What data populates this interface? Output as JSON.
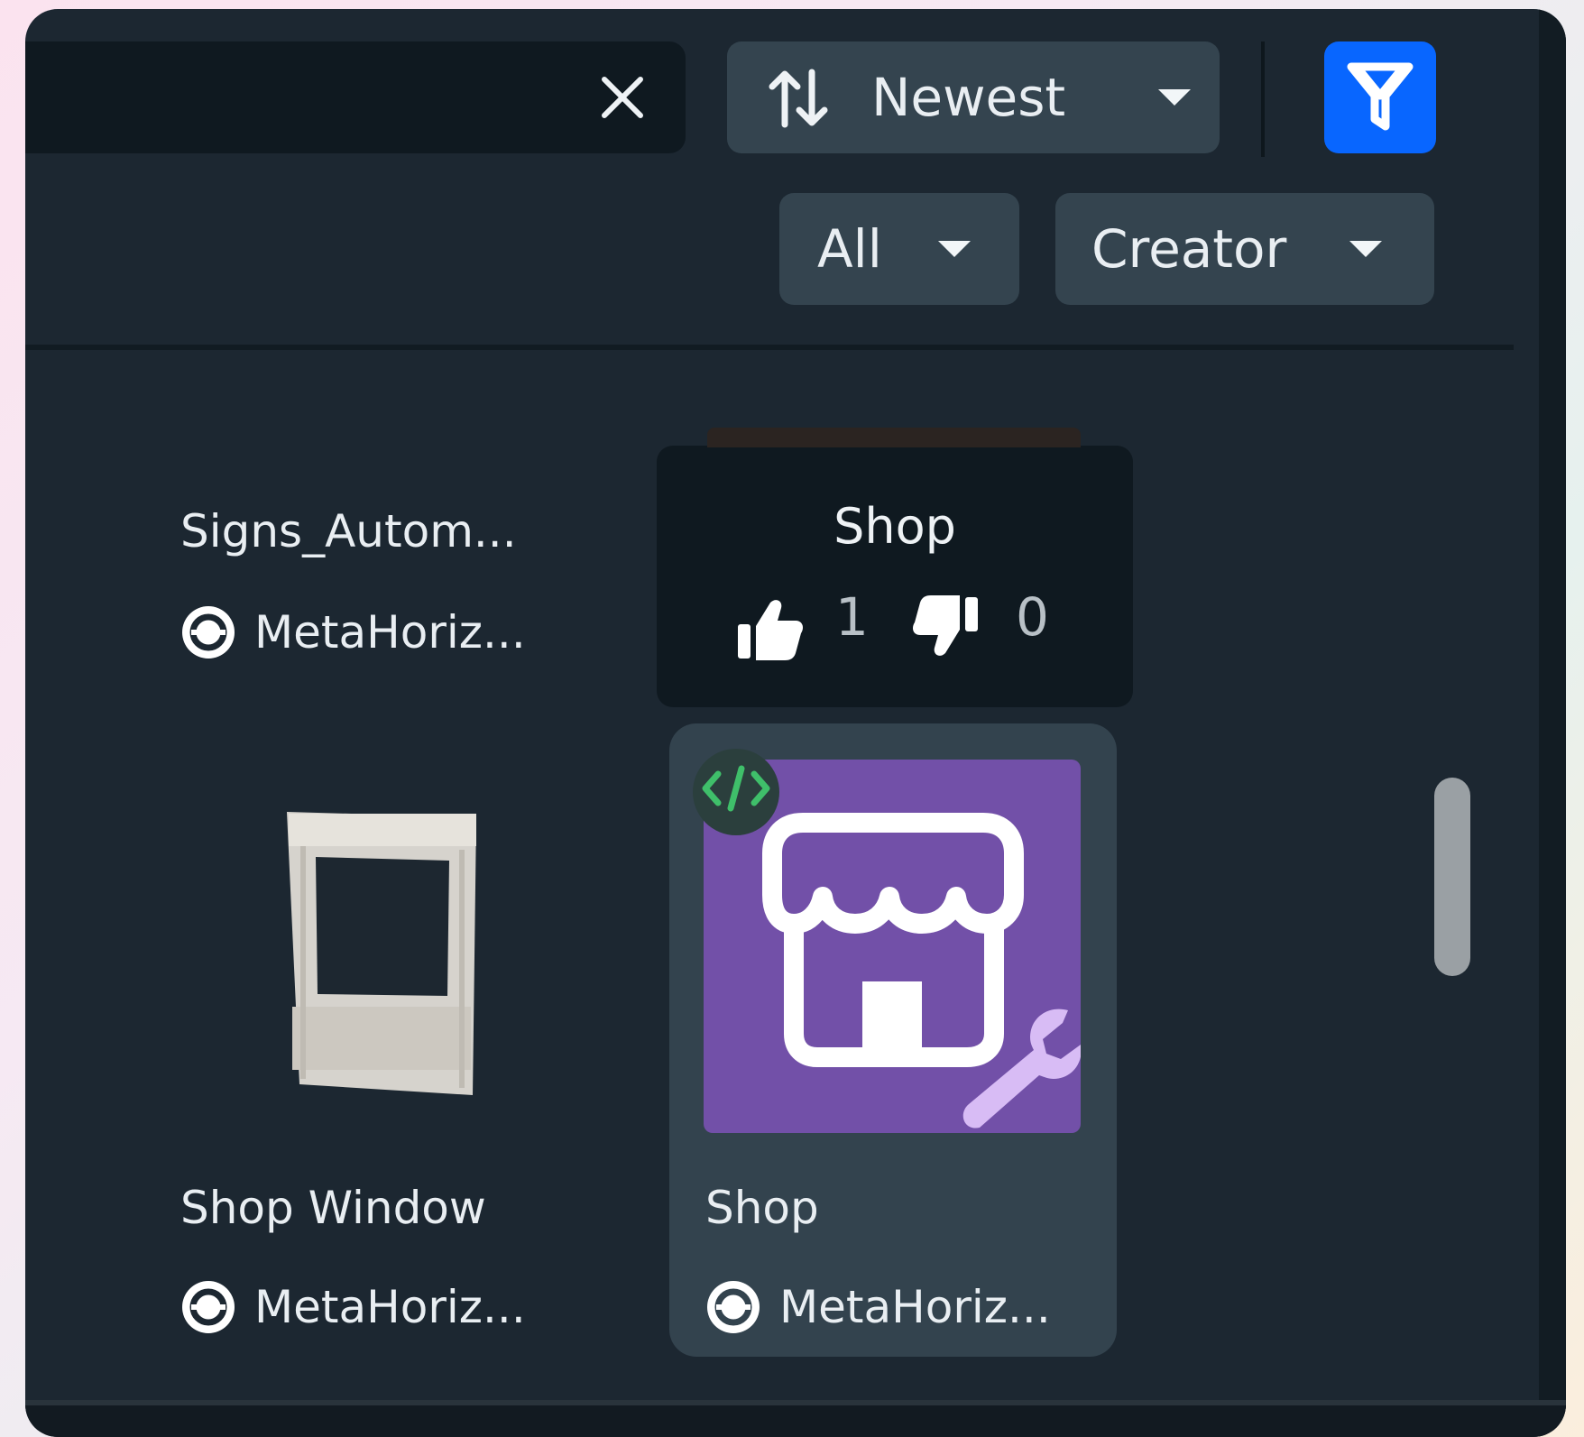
{
  "search": {
    "value": "",
    "placeholder": ""
  },
  "sort": {
    "label": "Newest"
  },
  "filters": {
    "type_label": "All",
    "creator_label": "Creator"
  },
  "tooltip": {
    "title": "Shop",
    "likes": "1",
    "dislikes": "0"
  },
  "assets": [
    {
      "title": "Signs_Autom...",
      "creator": "MetaHoriz..."
    },
    {
      "title": "Shop Window",
      "creator": "MetaHoriz..."
    },
    {
      "title": "Shop",
      "creator": "MetaHoriz...",
      "code_badge": "</>"
    }
  ],
  "colors": {
    "panel": "#1c2731",
    "filter_accent": "#0866ff",
    "shop_thumb": "#7250a8",
    "wrench": "#d8bcf5",
    "code_badge": "#3fbf6a"
  },
  "icons": [
    "close-icon",
    "sort-icon",
    "caret-down-icon",
    "filter-icon",
    "thumbs-up-icon",
    "thumbs-down-icon",
    "creator-icon",
    "store-icon",
    "wrench-icon",
    "code-icon"
  ]
}
